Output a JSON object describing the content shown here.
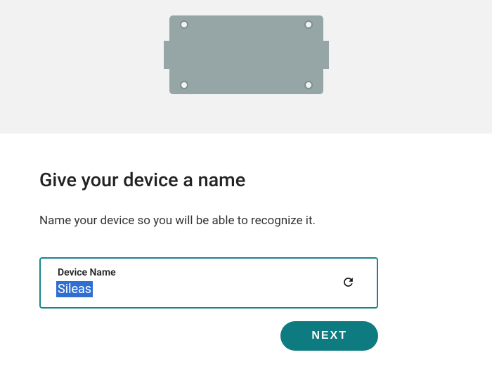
{
  "heading": "Give your device a name",
  "subheading": "Name your device so you will be able to recognize it.",
  "form": {
    "deviceName": {
      "label": "Device Name",
      "value": "Sileas"
    }
  },
  "actions": {
    "next_label": "NEXT"
  },
  "icons": {
    "refresh": "refresh-icon"
  },
  "colors": {
    "accent": "#0d7b80",
    "focus_border": "#17858a",
    "hero_bg": "#f2f2f2",
    "device_fill": "#96a6a6",
    "selection": "#2f6fd1"
  }
}
